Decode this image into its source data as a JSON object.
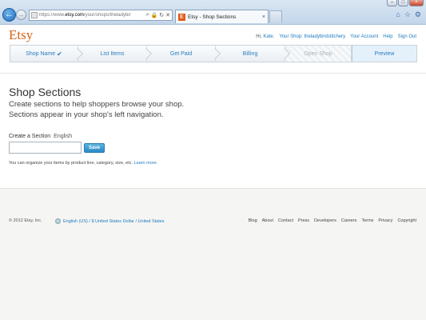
{
  "browser": {
    "url_prefix": "https://www.",
    "url_domain": "etsy.com",
    "url_path": "/your/shops/theladybir",
    "tab_title": "Etsy - Shop Sections",
    "tab_favicon": "E"
  },
  "header": {
    "logo": "Etsy",
    "greeting": "Hi,",
    "user": "Kate.",
    "your_shop": "Your Shop: theladybirdstitchery",
    "your_account": "Your Account",
    "help": "Help",
    "sign_out": "Sign Out"
  },
  "steps": [
    {
      "label": "Shop Name",
      "done": true
    },
    {
      "label": "List Items"
    },
    {
      "label": "Get Paid"
    },
    {
      "label": "Billing"
    },
    {
      "label": "Open Shop"
    },
    {
      "label": "Preview"
    }
  ],
  "main": {
    "title": "Shop Sections",
    "subtitle_line1": "Create sections to help shoppers browse your shop.",
    "subtitle_line2": "Sections appear in your shop's left navigation.",
    "create_label": "Create a Section",
    "language": "English",
    "input_value": "",
    "save_label": "Save",
    "help_text": "You can organize your items by product line, category, size, etc.",
    "learn_more": "Learn more."
  },
  "footer": {
    "copyright": "© 2012 Etsy, Inc.",
    "locale": "English (US) / $ United States Dollar / United States",
    "links": [
      "Blog",
      "About",
      "Contact",
      "Press",
      "Developers",
      "Careers",
      "Terms",
      "Privacy",
      "Copyright"
    ]
  },
  "colors": {
    "brand": "#d5641c",
    "link": "#1c7bbf",
    "save_button": "#2a8ac6"
  }
}
